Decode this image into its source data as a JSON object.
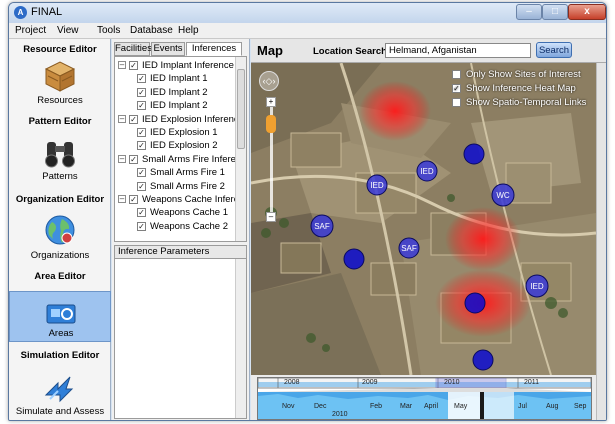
{
  "window": {
    "title": "FINAL",
    "app_icon": "A",
    "minimize_glyph": "–",
    "maximize_glyph": "□",
    "close_glyph": "x"
  },
  "menu": [
    "Project",
    "View",
    "Tools",
    "Database",
    "Help"
  ],
  "left_panel": {
    "sections": [
      {
        "title": "Resource Editor",
        "tools": [
          {
            "label": "Resources",
            "icon": "crate-icon"
          }
        ]
      },
      {
        "title": "Pattern Editor",
        "tools": [
          {
            "label": "Patterns",
            "icon": "binoculars-icon"
          }
        ]
      },
      {
        "title": "Organization Editor",
        "tools": [
          {
            "label": "Organizations",
            "icon": "globe-icon"
          }
        ]
      },
      {
        "title": "Area Editor",
        "tools": [
          {
            "label": "Areas",
            "icon": "area-map-icon",
            "selected": true
          }
        ]
      },
      {
        "title": "Simulation Editor",
        "tools": [
          {
            "label": "Simulate and Assess",
            "icon": "arrows-icon"
          }
        ]
      }
    ]
  },
  "tabs": [
    {
      "label": "Facilities",
      "active": false
    },
    {
      "label": "Events",
      "active": false
    },
    {
      "label": "Inferences",
      "active": true
    }
  ],
  "tree": [
    {
      "label": "IED Implant Inference",
      "level": 0,
      "checked": true
    },
    {
      "label": "IED Implant 1",
      "level": 1,
      "checked": true
    },
    {
      "label": "IED Implant 2",
      "level": 1,
      "checked": true
    },
    {
      "label": "IED Implant 2",
      "level": 1,
      "checked": true
    },
    {
      "label": "IED Explosion Inference",
      "level": 0,
      "checked": true
    },
    {
      "label": "IED Explosion 1",
      "level": 1,
      "checked": true
    },
    {
      "label": "IED Explosion 2",
      "level": 1,
      "checked": true
    },
    {
      "label": "Small Arms Fire Infere...",
      "level": 0,
      "checked": true
    },
    {
      "label": "Small Arms Fire 1",
      "level": 1,
      "checked": true
    },
    {
      "label": "Small Arms Fire 2",
      "level": 1,
      "checked": true
    },
    {
      "label": "Weapons Cache Infere...",
      "level": 0,
      "checked": true
    },
    {
      "label": "Weapons Cache 1",
      "level": 1,
      "checked": true
    },
    {
      "label": "Weapons Cache 2",
      "level": 1,
      "checked": true
    }
  ],
  "inference_parameters": {
    "title": "Inference Parameters"
  },
  "map": {
    "title": "Map",
    "location_label": "Location Search",
    "location_value": "Helmand, Afganistan",
    "search_label": "Search",
    "options": [
      {
        "label": "Only Show Sites of Interest",
        "checked": false
      },
      {
        "label": "Show Inference Heat Map",
        "checked": true
      },
      {
        "label": "Show Spatio-Temporal Links",
        "checked": false
      }
    ],
    "markers": [
      {
        "label": "",
        "color": "#0a0ad0"
      },
      {
        "label": "IED",
        "color": "#3a3ad8"
      },
      {
        "label": "IED",
        "color": "#3a3ad8"
      },
      {
        "label": "",
        "color": "#0a0ad0"
      },
      {
        "label": "WC",
        "color": "#3a3ad8"
      },
      {
        "label": "SAF",
        "color": "#3a3ad8"
      },
      {
        "label": "SAF",
        "color": "#3a3ad8"
      },
      {
        "label": "",
        "color": "#0a0ad0"
      },
      {
        "label": "IED",
        "color": "#3a3ad8"
      },
      {
        "label": "",
        "color": "#0a0ad0"
      }
    ],
    "nav_glyph": "‹◇›",
    "zoom_in": "+",
    "zoom_out": "–"
  },
  "timeline": {
    "year_labels": [
      "2008",
      "2009",
      "2010",
      "2011"
    ],
    "month_labels": [
      "Nov",
      "Dec",
      "Feb",
      "Mar",
      "April",
      "May",
      "Jul",
      "Aug",
      "Sep"
    ],
    "detail_year": "2010"
  }
}
